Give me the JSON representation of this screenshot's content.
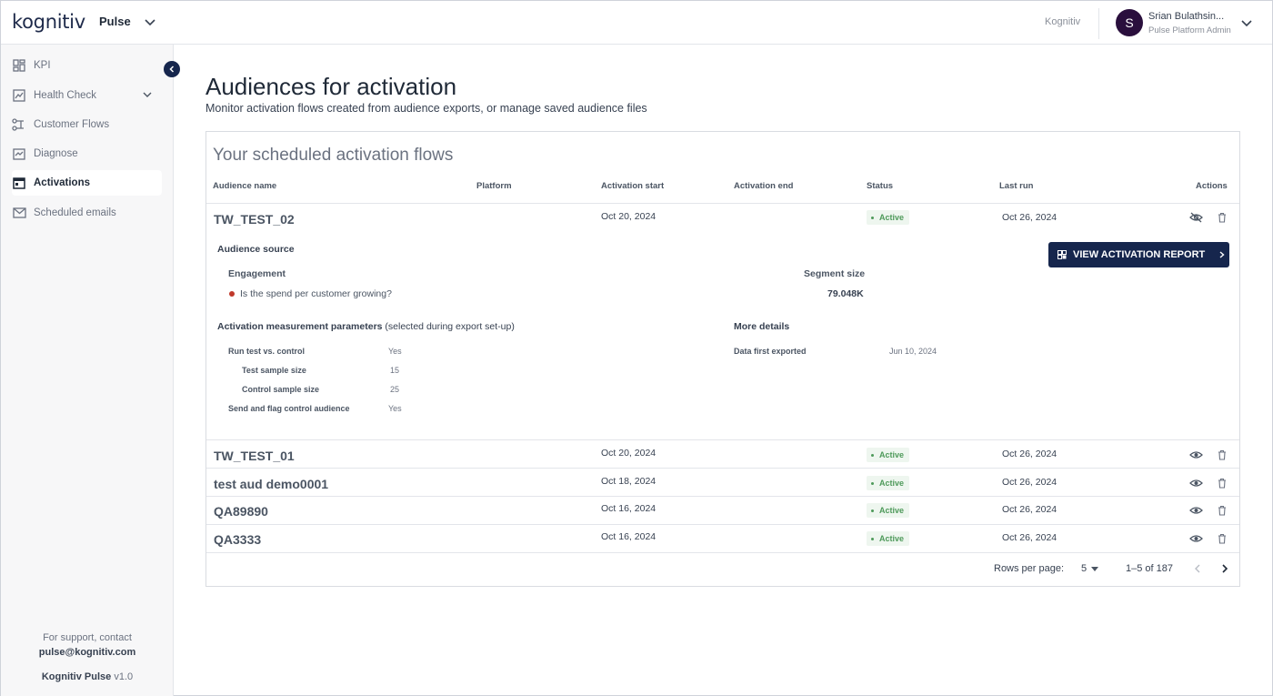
{
  "header": {
    "logo_text": "kognitiv",
    "app_name": "Pulse",
    "org_name": "Kognitiv",
    "user_initial": "S",
    "user_name": "Srian Bulathsin...",
    "user_role": "Pulse Platform Admin"
  },
  "sidebar": {
    "items": [
      {
        "label": "KPI",
        "icon": "dashboard-icon"
      },
      {
        "label": "Health Check",
        "icon": "chart-icon"
      },
      {
        "label": "Customer Flows",
        "icon": "flow-icon"
      },
      {
        "label": "Diagnose",
        "icon": "diagnose-icon"
      },
      {
        "label": "Activations",
        "icon": "calendar-icon"
      },
      {
        "label": "Scheduled emails",
        "icon": "mail-icon"
      }
    ],
    "active_index": 4,
    "support_line1": "For support, contact",
    "support_email": "pulse@kognitiv.com",
    "version_brand": "Kognitiv Pulse",
    "version": "v1.0"
  },
  "page": {
    "title": "Audiences for activation",
    "subtitle": "Monitor activation flows created from audience exports, or manage saved audience files"
  },
  "table": {
    "title": "Your scheduled activation flows",
    "columns": [
      "Audience name",
      "Platform",
      "Activation start",
      "Activation end",
      "Status",
      "Last run",
      "Actions"
    ],
    "rows": [
      {
        "name": "TW_TEST_02",
        "platform": "",
        "start": "Oct 20, 2024",
        "end": "",
        "status": "Active",
        "last_run": "Oct 26, 2024",
        "expanded": true
      },
      {
        "name": "TW_TEST_01",
        "platform": "",
        "start": "Oct 20, 2024",
        "end": "",
        "status": "Active",
        "last_run": "Oct 26, 2024"
      },
      {
        "name": "test aud demo0001",
        "platform": "",
        "start": "Oct 18, 2024",
        "end": "",
        "status": "Active",
        "last_run": "Oct 26, 2024"
      },
      {
        "name": "QA89890",
        "platform": "",
        "start": "Oct 16, 2024",
        "end": "",
        "status": "Active",
        "last_run": "Oct 26, 2024"
      },
      {
        "name": "QA3333",
        "platform": "",
        "start": "Oct 16, 2024",
        "end": "",
        "status": "Active",
        "last_run": "Oct 26, 2024"
      }
    ],
    "rows_per_page_label": "Rows per page:",
    "rows_per_page": "5",
    "range_text": "1–5 of 187"
  },
  "detail": {
    "audience_source_label": "Audience source",
    "engagement_label": "Engagement",
    "question": "Is the spend per customer growing?",
    "segment_size_label": "Segment size",
    "segment_size": "79.048K",
    "report_button": "VIEW ACTIVATION REPORT",
    "params_label": "Activation measurement parameters",
    "params_note": "(selected during export set-up)",
    "params": [
      {
        "label": "Run test vs. control",
        "value": "Yes"
      },
      {
        "label": "Test sample size",
        "value": "15"
      },
      {
        "label": "Control sample size",
        "value": "25"
      },
      {
        "label": "Send and flag control audience",
        "value": "Yes"
      }
    ],
    "more_details_label": "More details",
    "data_first_exported_label": "Data first exported",
    "data_first_exported": "Jun 10, 2024"
  },
  "colors": {
    "navy": "#16264d",
    "active_green": "#4e9a5a",
    "active_bg": "#eef6ef",
    "question_dot": "#c0392b"
  }
}
